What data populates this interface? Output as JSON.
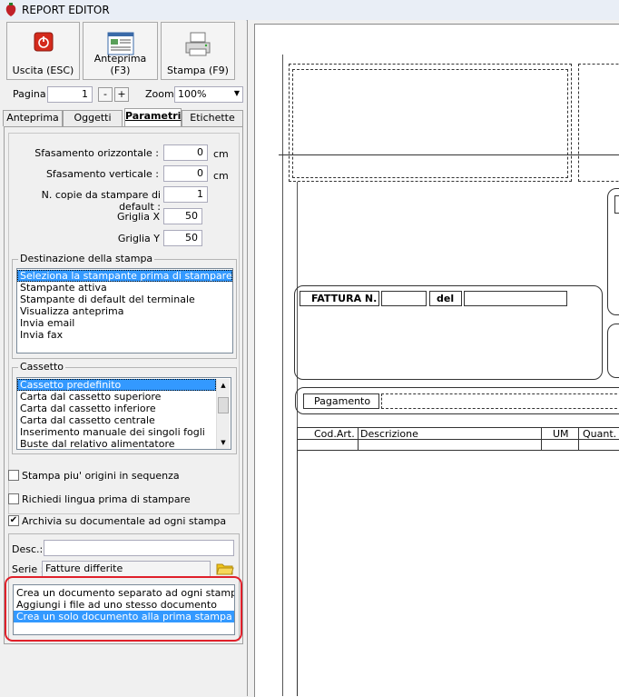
{
  "window": {
    "title": "REPORT EDITOR"
  },
  "toolbar": {
    "exit_label": "Uscita (ESC)",
    "preview_label": "Anteprima (F3)",
    "print_label": "Stampa (F9)"
  },
  "pager": {
    "page_label": "Pagina",
    "page_value": "1",
    "minus": "-",
    "plus": "+",
    "zoom_label": "Zoom",
    "zoom_value": "100%"
  },
  "tabs": [
    "Anteprima",
    "Oggetti",
    "Parametri",
    "Etichette"
  ],
  "params": {
    "offset_h_label": "Sfasamento orizzontale :",
    "offset_h_value": "0",
    "offset_h_unit": "cm",
    "offset_v_label": "Sfasamento verticale :",
    "offset_v_value": "0",
    "offset_v_unit": "cm",
    "copies_label": "N. copie da stampare di default :",
    "copies_value": "1",
    "grid_x_label": "Griglia X",
    "grid_x_value": "50",
    "grid_y_label": "Griglia Y",
    "grid_y_value": "50"
  },
  "destination": {
    "title": "Destinazione della stampa",
    "items": [
      "Seleziona la stampante prima di stampare",
      "Stampante attiva",
      "Stampante di default del terminale",
      "Visualizza anteprima",
      "Invia email",
      "Invia fax"
    ],
    "selected": 0
  },
  "tray": {
    "title": "Cassetto",
    "items": [
      "Cassetto predefinito",
      "Carta dal cassetto superiore",
      "Carta dal cassetto inferiore",
      "Carta dal cassetto centrale",
      "Inserimento manuale dei singoli fogli",
      "Buste dal relativo alimentatore"
    ],
    "selected": 0
  },
  "options": {
    "multi_origin": {
      "label": "Stampa piu' origini in sequenza",
      "checked": false
    },
    "ask_language": {
      "label": "Richiedi lingua prima di stampare",
      "checked": false
    },
    "archive": {
      "label": "Archivia su documentale ad ogni stampa",
      "checked": true
    }
  },
  "archive": {
    "desc_label": "Desc.:",
    "desc_value": "",
    "series_label": "Serie :",
    "series_value": "Fatture differite",
    "mode_items": [
      "Crea un documento separato ad ogni stampa",
      "Aggiungi i file ad uno stesso documento",
      "Crea un solo documento alla prima stampa"
    ],
    "mode_selected": 2
  },
  "report": {
    "invoice_label": "FATTURA N.",
    "date_label": "del",
    "payment_label": "Pagamento",
    "columns": [
      "Cod.Art.",
      "Descrizione",
      "UM",
      "Quant."
    ]
  },
  "colors": {
    "selection": "#3399ff",
    "highlight_ring": "#e0202a"
  }
}
